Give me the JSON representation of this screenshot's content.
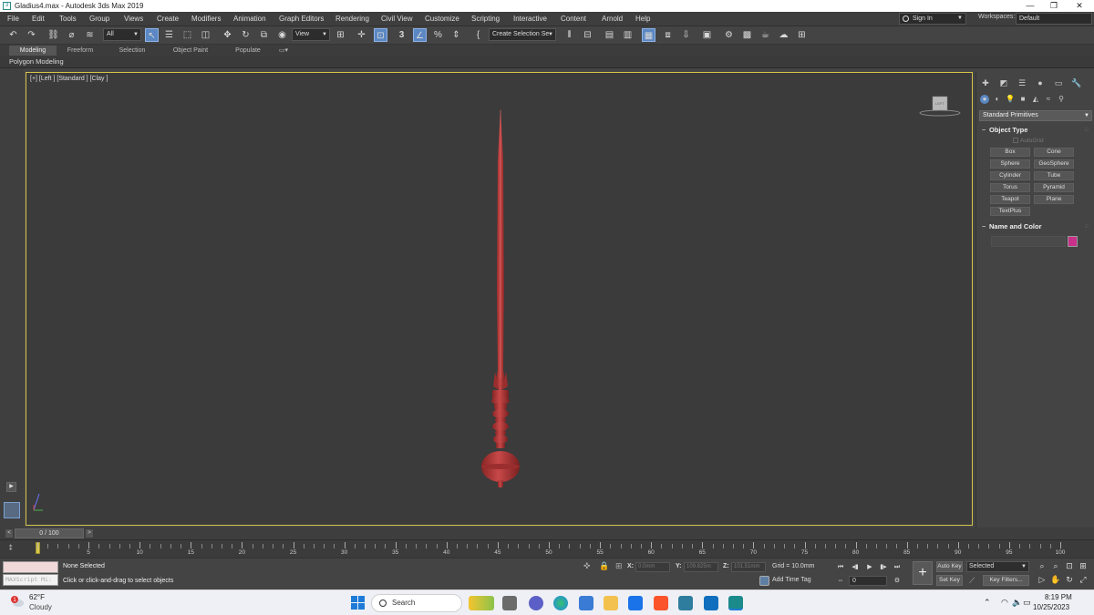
{
  "titlebar": {
    "title": "Gladius4.max - Autodesk 3ds Max 2019",
    "minimize": "—",
    "maximize": "❐",
    "close": "✕"
  },
  "menu": [
    "File",
    "Edit",
    "Tools",
    "Group",
    "Views",
    "Create",
    "Modifiers",
    "Animation",
    "Graph Editors",
    "Rendering",
    "Civil View",
    "Customize",
    "Scripting",
    "Interactive",
    "Content",
    "Arnold",
    "Help"
  ],
  "account": {
    "sign_in": "Sign In",
    "workspaces_label": "Workspaces:",
    "workspace": "Default"
  },
  "toolbar": {
    "selection_filter": "All",
    "ref_coord": "View",
    "snap_label": "3",
    "named_selection": "Create Selection Se"
  },
  "ribbon": {
    "tabs": [
      "Modeling",
      "Freeform",
      "Selection",
      "Object Paint",
      "Populate"
    ],
    "active_tab": "Modeling",
    "panel_label": "Polygon Modeling"
  },
  "viewport": {
    "label": "[+] [Left ] [Standard ] [Clay ]",
    "model_color": "#b43c3c",
    "border_color": "#d4c44c"
  },
  "command_panel": {
    "category": "Standard Primitives",
    "object_type_title": "Object Type",
    "autogrid": "AutoGrid",
    "buttons": [
      "Box",
      "Cone",
      "Sphere",
      "GeoSphere",
      "Cylinder",
      "Tube",
      "Torus",
      "Pyramid",
      "Teapot",
      "Plane",
      "TextPlus"
    ],
    "name_color_title": "Name and Color",
    "swatch_color": "#c8308a"
  },
  "timeslider": {
    "label": "0 / 100",
    "prev": "<",
    "next": ">"
  },
  "trackbar": {
    "labels": [
      "0",
      "5",
      "10",
      "15",
      "20",
      "25",
      "30",
      "35",
      "40",
      "45",
      "50",
      "55",
      "60",
      "65",
      "70",
      "75",
      "80",
      "85",
      "90",
      "95",
      "100"
    ]
  },
  "status": {
    "selection": "None Selected",
    "prompt": "Click or click-and-drag to select objects",
    "maxscript": "MAXScript Mi:",
    "x_label": "X:",
    "y_label": "Y:",
    "z_label": "Z:",
    "x_value": "0.0mm",
    "y_value": "109.825m",
    "z_value": "101.51mm",
    "grid": "Grid = 10.0mm",
    "add_time_tag": "Add Time Tag",
    "frame": "0",
    "auto_key": "Auto Key",
    "set_key": "Set Key",
    "key_mode": "Selected",
    "key_filters": "Key Filters..."
  },
  "taskbar": {
    "temperature": "62°F",
    "weather": "Cloudy",
    "search": "Search",
    "time": "8:19 PM",
    "date": "10/25/2023"
  }
}
